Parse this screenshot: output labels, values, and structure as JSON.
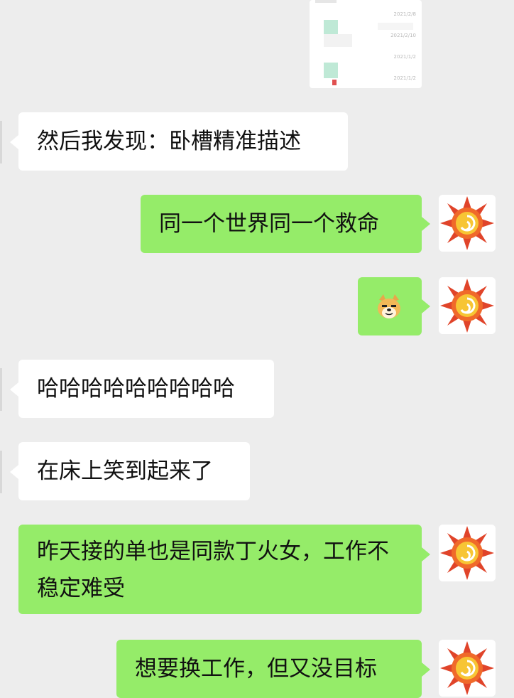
{
  "colors": {
    "background": "#ededed",
    "incoming_bubble": "#ffffff",
    "outgoing_bubble": "#95ec69"
  },
  "shared_screenshot": {
    "dates": [
      "2021/2/8",
      "2021/2/10",
      "2021/1/2",
      "2021/1/2"
    ]
  },
  "messages": [
    {
      "side": "left",
      "text": "然后我发现：卧槽精准描述"
    },
    {
      "side": "right",
      "text": "同一个世界同一个救命"
    },
    {
      "side": "right",
      "emoji": "doge-emoji"
    },
    {
      "side": "left",
      "text": "哈哈哈哈哈哈哈哈哈"
    },
    {
      "side": "left",
      "text": "在床上笑到起来了"
    },
    {
      "side": "right",
      "text": "昨天接的单也是同款丁火女，工作不稳定难受"
    },
    {
      "side": "right",
      "text": "想要换工作，但又没目标"
    }
  ]
}
